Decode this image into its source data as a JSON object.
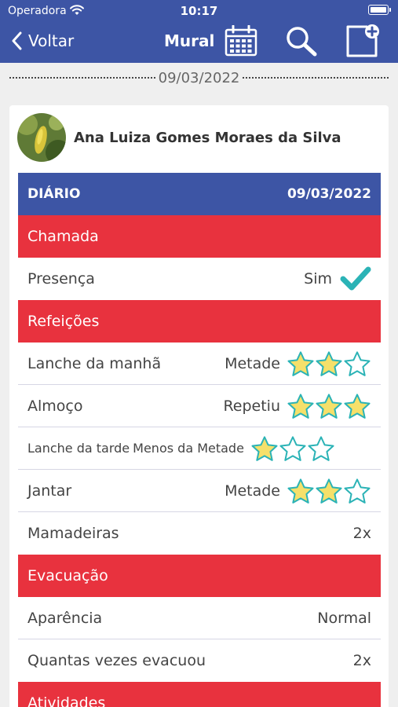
{
  "status_bar": {
    "carrier": "Operadora",
    "time": "10:17"
  },
  "nav": {
    "back_label": "Voltar",
    "title": "Mural"
  },
  "date_separator": "09/03/2022",
  "post": {
    "author_name": "Ana Luiza Gomes Moraes da Silva",
    "diary": {
      "title": "DIÁRIO",
      "date": "09/03/2022",
      "chamada": {
        "title": "Chamada",
        "presence_label": "Presença",
        "presence_value": "Sim"
      },
      "refeicoes": {
        "title": "Refeições",
        "items": [
          {
            "label": "Lanche da manhã",
            "value": "Metade",
            "rating": 2
          },
          {
            "label": "Almoço",
            "value": "Repetiu",
            "rating": 3
          },
          {
            "label": "Lanche da tarde",
            "value": "Menos da Metade",
            "rating": 1
          },
          {
            "label": "Jantar",
            "value": "Metade",
            "rating": 2
          }
        ],
        "mamadeiras_label": "Mamadeiras",
        "mamadeiras_value": "2x"
      },
      "evacuacao": {
        "title": "Evacuação",
        "items": [
          {
            "label": "Aparência",
            "value": "Normal"
          },
          {
            "label": "Quantas vezes evacuou",
            "value": "2x"
          }
        ]
      },
      "atividades": {
        "title": "Atividades"
      }
    }
  },
  "colors": {
    "primary": "#3d55a5",
    "section": "#e8323e",
    "star_fill": "#f5e06a",
    "star_stroke": "#2bb3b6",
    "check": "#2bb3b6"
  }
}
